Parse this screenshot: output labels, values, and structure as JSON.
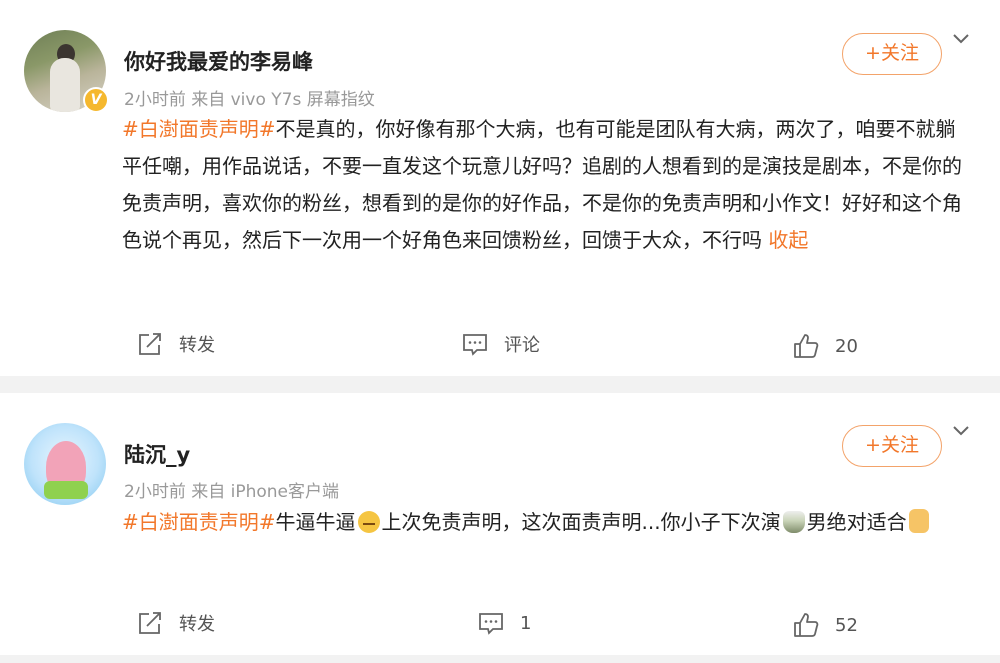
{
  "posts": [
    {
      "username": "你好我最爱的李易峰",
      "meta": "2小时前  来自 vivo Y7s 屏幕指纹",
      "follow_label": "+关注",
      "hashtag": "#白澍面责声明#",
      "text": "不是真的，你好像有那个大病，也有可能是团队有大病，两次了，咱要不就躺平任嘲，用作品说话，不要一直发这个玩意儿好吗？追剧的人想看到的是演技是剧本，不是你的免责声明，喜欢你的粉丝，想看到的是你的好作品，不是你的免责声明和小作文！好好和这个角色说个再见，然后下一次用一个好角色来回馈粉丝，回馈于大众，不行吗 ",
      "fold_label": "收起",
      "actions": {
        "repost": "转发",
        "comment": "评论",
        "likes": "20"
      },
      "avatar_badge": "V"
    },
    {
      "username": "陆沉_y",
      "meta": "2小时前  来自 iPhone客户端",
      "follow_label": "+关注",
      "hashtag": "#白澍面责声明#",
      "text_a": "牛逼牛逼",
      "text_b": "上次免责声明，这次面责声明...你小子下次演",
      "text_c": "男绝对适合",
      "actions": {
        "repost": "转发",
        "comment": "1",
        "likes": "52"
      }
    }
  ],
  "icons": [
    "chevron-down-icon",
    "repost-icon",
    "comment-icon",
    "like-icon",
    "smirk-emoji",
    "tea-emoji",
    "thumbs-up-emoji"
  ],
  "colors": {
    "accent": "#f2772a",
    "muted": "#999999",
    "separator": "#f2f2f2"
  }
}
